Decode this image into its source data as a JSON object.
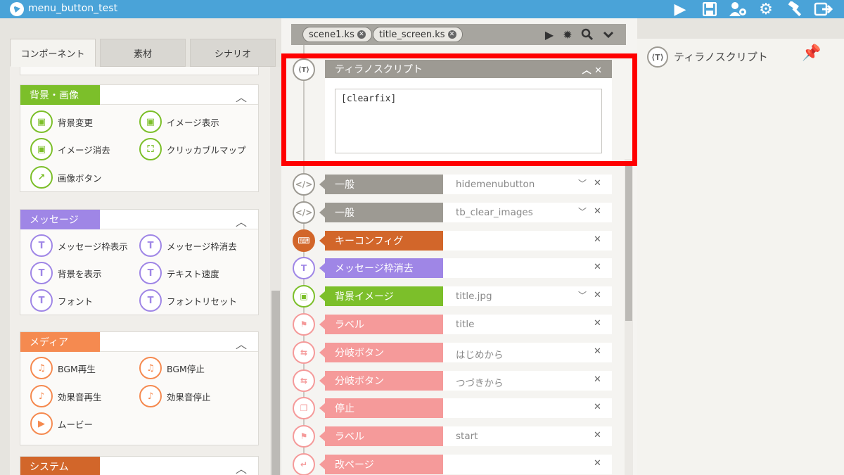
{
  "titlebar": {
    "title": "menu_button_test",
    "icons": [
      "play-icon",
      "save-icon",
      "settings-user-icon",
      "gear-icon",
      "hammer-icon",
      "export-icon"
    ]
  },
  "left": {
    "tabs": [
      "コンポーネント",
      "素材",
      "シナリオ"
    ],
    "groups": [
      {
        "label": "背景・画像",
        "color": "#7cbf2a",
        "items": [
          "背景変更",
          "イメージ表示",
          "イメージ消去",
          "クリッカブルマップ",
          "画像ボタン"
        ]
      },
      {
        "label": "メッセージ",
        "color": "#9f86e6",
        "items": [
          "メッセージ枠表示",
          "メッセージ枠消去",
          "背景を表示",
          "テキスト速度",
          "フォント",
          "フォントリセット"
        ]
      },
      {
        "label": "メディア",
        "color": "#f58a50",
        "items": [
          "BGM再生",
          "BGM停止",
          "効果音再生",
          "効果音停止",
          "ムービー"
        ]
      },
      {
        "label": "システム",
        "color": "#d2662a",
        "items": []
      }
    ]
  },
  "mid": {
    "file_tabs": [
      "scene1.ks",
      "title_screen.ks"
    ],
    "tyrano": {
      "label": "ティラノスクリプト",
      "content": "[clearfix]"
    },
    "rows": [
      {
        "label": "一般",
        "value": "hidemenubutton",
        "color": "#9d9a93",
        "icon": "</>",
        "chev": true
      },
      {
        "label": "一般",
        "value": "tb_clear_images",
        "color": "#9d9a93",
        "icon": "</>",
        "chev": true
      },
      {
        "label": "キーコンフィグ",
        "value": "",
        "color": "#d2662a",
        "icon": "⌨",
        "chev": false
      },
      {
        "label": "メッセージ枠消去",
        "value": "",
        "color": "#9f86e6",
        "icon": "T",
        "chev": false
      },
      {
        "label": "背景イメージ",
        "value": "title.jpg",
        "color": "#7cbf2a",
        "icon": "▣",
        "chev": true
      },
      {
        "label": "ラベル",
        "value": "title",
        "color": "#f59a9a",
        "icon": "⚑",
        "chev": false
      },
      {
        "label": "分岐ボタン",
        "value": "はじめから",
        "color": "#f59a9a",
        "icon": "⇆",
        "chev": false
      },
      {
        "label": "分岐ボタン",
        "value": "つづきから",
        "color": "#f59a9a",
        "icon": "⇆",
        "chev": false
      },
      {
        "label": "停止",
        "value": "",
        "color": "#f59a9a",
        "icon": "❐",
        "chev": false
      },
      {
        "label": "ラベル",
        "value": "start",
        "color": "#f59a9a",
        "icon": "⚑",
        "chev": false
      },
      {
        "label": "改ページ",
        "value": "",
        "color": "#f59a9a",
        "icon": "↵",
        "chev": false
      }
    ]
  },
  "right": {
    "title": "ティラノスクリプト"
  }
}
